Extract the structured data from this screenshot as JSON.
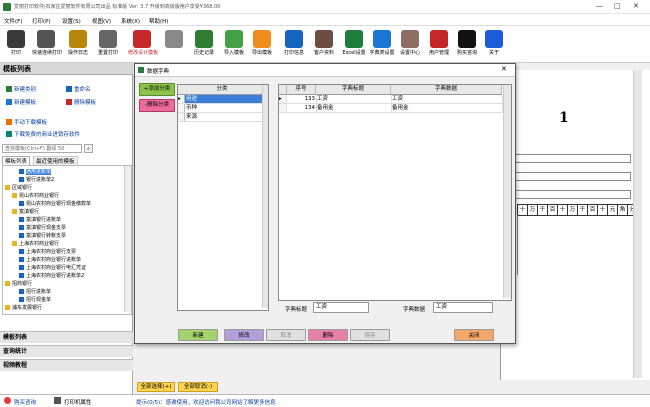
{
  "window": {
    "title": "爱丽打印软件|石家庄爱丽软件有限公司出品 标准版  Ver: 3.7   升级到高级版用户享受¥368.00",
    "controls": [
      "—",
      "□",
      "✕"
    ]
  },
  "menu": [
    "文件(F)",
    "打印(P)",
    "设置(S)",
    "视图(V)",
    "系统(X)",
    "帮助(H)"
  ],
  "toolbar": [
    {
      "label": "打印",
      "icon": "printer-icon",
      "color": "#3a3a3a"
    },
    {
      "label": "快速连续打印",
      "icon": "fast-print-icon",
      "color": "#555555"
    },
    {
      "label": "操作日志",
      "icon": "log-icon",
      "color": "#b8860b"
    },
    {
      "label": "重置打印",
      "icon": "reset-print-icon",
      "color": "#666666"
    },
    {
      "label": "修改设计模板",
      "icon": "edit-template-icon",
      "color": "#c62828"
    },
    {
      "label": "",
      "icon": "search-doc-icon",
      "color": "#888888"
    },
    {
      "label": "历史记录",
      "icon": "history-icon",
      "color": "#2e7d32"
    },
    {
      "label": "导入模板",
      "icon": "import-icon",
      "color": "#43a047"
    },
    {
      "label": "导出模板",
      "icon": "export-icon",
      "color": "#ef8c1a"
    },
    {
      "label": "打印信息",
      "icon": "bank-icon",
      "color": "#1565c0"
    },
    {
      "label": "客户资料",
      "icon": "customers-icon",
      "color": "#6d4c41"
    },
    {
      "label": "Excel设置",
      "icon": "excel-icon",
      "color": "#1b7e3a"
    },
    {
      "label": "字典类设置",
      "icon": "dictionary-icon",
      "color": "#1976d2"
    },
    {
      "label": "设置中心",
      "icon": "tools-icon",
      "color": "#8d6e63"
    },
    {
      "label": "用户管理",
      "icon": "user-manage-icon",
      "color": "#c62828"
    },
    {
      "label": "购买咨询",
      "icon": "qq-icon",
      "color": "#111111"
    },
    {
      "label": "关于",
      "icon": "info-icon",
      "color": "#1e5bd8"
    }
  ],
  "left": {
    "header": "模板列表",
    "actions": {
      "new_category": "新建类别",
      "rename": "重命名",
      "new_template": "新建模板",
      "delete_template": "删除模板",
      "manual_download": "手动下载模板",
      "download_software": "下载免费的商业进销存软件"
    },
    "search_placeholder": "查找模板(Ctrl+F) 翻译 50",
    "tabs": [
      "模板列表",
      "最近使用的模板"
    ],
    "tree": [
      {
        "level": 3,
        "text": "通用进账单",
        "sel": true
      },
      {
        "level": 3,
        "text": "银行进账单2"
      },
      {
        "level": 1,
        "text": "区域银行"
      },
      {
        "level": 2,
        "text": "昆山农村商业银行"
      },
      {
        "level": 3,
        "text": "昆山农村商业银行现金缴款单"
      },
      {
        "level": 2,
        "text": "富滇银行"
      },
      {
        "level": 3,
        "text": "富滇银行进账单"
      },
      {
        "level": 3,
        "text": "富滇银行现金支票"
      },
      {
        "level": 3,
        "text": "富滇银行转账支票"
      },
      {
        "level": 2,
        "text": "上海农村商业银行"
      },
      {
        "level": 3,
        "text": "上海农村商业银行支票"
      },
      {
        "level": 3,
        "text": "上海农村商业银行进账单"
      },
      {
        "level": 3,
        "text": "上海农村商业银行电汇凭证"
      },
      {
        "level": 3,
        "text": "上海农村商业银行进账单2"
      },
      {
        "level": 1,
        "text": "招商银行"
      },
      {
        "level": 3,
        "text": "招行进账单"
      },
      {
        "level": 3,
        "text": "招行现金单"
      },
      {
        "level": 1,
        "text": "浦东发展银行"
      }
    ],
    "accordion": [
      "模板列表",
      "查询统计",
      "视频教程"
    ]
  },
  "dialog": {
    "title": "数据字典",
    "add_category": "+添加分类",
    "delete_category": "-删除分类",
    "category_header": "分类",
    "categories": [
      "用途",
      "币种",
      "来源"
    ],
    "item_headers": [
      "序号",
      "字典标题",
      "字典数据"
    ],
    "items": [
      {
        "no": "133",
        "title": "工资",
        "data": "工资"
      },
      {
        "no": "134",
        "title": "备用金",
        "data": "备用金"
      }
    ],
    "label_title": "字典标题",
    "value_title": "工资",
    "label_data": "字典数据",
    "value_data": "工资",
    "buttons": {
      "new": "新建",
      "edit": "修改",
      "cancel": "取消",
      "delete": "删除",
      "save": "保存",
      "close": "关闭"
    }
  },
  "doc": {
    "page_number": "1",
    "digits": [
      "十",
      "万",
      "千",
      "百",
      "十",
      "万",
      "千",
      "百",
      "十",
      "元",
      "角",
      "分"
    ]
  },
  "bottom": {
    "select_all": "全部选择(+)",
    "cancel_all": "全部取消(-)"
  },
  "status": {
    "buy": "购买咨询",
    "printer": "打印机属性",
    "tip": "提示(0/5)：感谢使用，欢迎访问我公司网站了解更多信息"
  }
}
